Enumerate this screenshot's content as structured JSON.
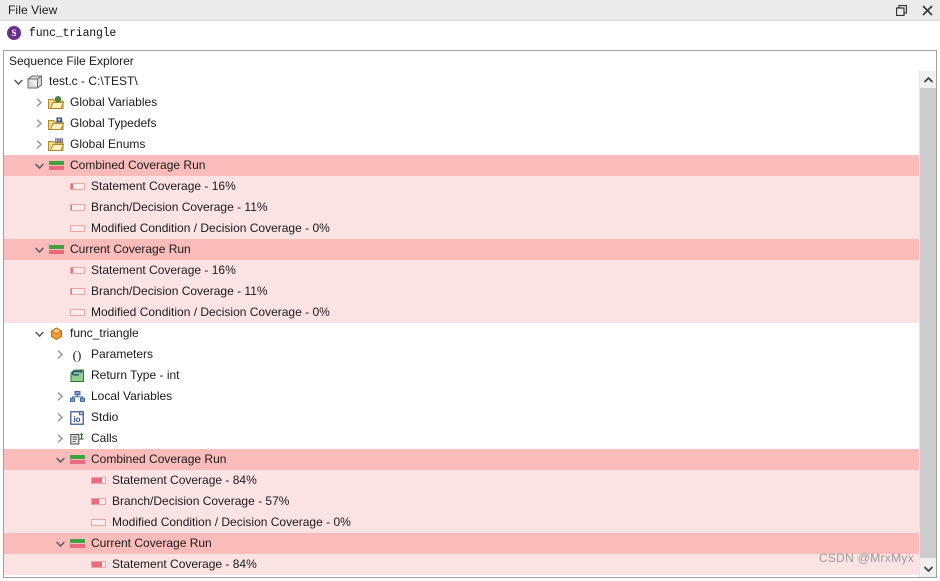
{
  "window": {
    "title": "File View",
    "controls": [
      {
        "name": "restore-window-button",
        "icon": "restore-icon"
      },
      {
        "name": "close-window-button",
        "icon": "close-icon"
      }
    ]
  },
  "tab": {
    "icon": "sequence-file-icon",
    "icon_letter": "S",
    "label": "func_triangle"
  },
  "explorer": {
    "header": "Sequence File Explorer"
  },
  "colors": {
    "highlight_dark": "#fabbbb",
    "highlight_light": "#fbe3e3",
    "coverage_fill": "#ea6b7e",
    "coverage_track": "#fdecec",
    "run_green": "#41a33f",
    "titlebar": "#ebebeb",
    "scrollbar_thumb": "#cdcdcd",
    "tab_icon": "#6b2f8e"
  },
  "scrollbar": {
    "up_arrow": "scroll-up-icon",
    "down_arrow": "scroll-down-icon",
    "thumb_name": "scrollbar-thumb"
  },
  "watermark": "CSDN @MrxMyx",
  "tree": {
    "rows": [
      {
        "id": "file-test-c",
        "label": "test.c - C:\\TEST\\",
        "indent": 0,
        "twisty": "expanded",
        "icon": "source-file-icon",
        "highlight": "none"
      },
      {
        "id": "global-variables",
        "label": "Global Variables",
        "indent": 1,
        "twisty": "collapsed",
        "icon": "folder-globe-icon",
        "highlight": "none"
      },
      {
        "id": "global-typedefs",
        "label": "Global Typedefs",
        "indent": 1,
        "twisty": "collapsed",
        "icon": "folder-typedef-icon",
        "highlight": "none"
      },
      {
        "id": "global-enums",
        "label": "Global Enums",
        "indent": 1,
        "twisty": "collapsed",
        "icon": "folder-enum-icon",
        "highlight": "none"
      },
      {
        "id": "file-combined-coverage-run",
        "label": "Combined Coverage Run",
        "indent": 1,
        "twisty": "expanded",
        "icon": "coverage-run-icon",
        "highlight": "dark"
      },
      {
        "id": "file-combined-statement-coverage",
        "label": "Statement Coverage - 16%",
        "indent": 2,
        "twisty": "none",
        "icon": "coverage-bar-icon",
        "percent": 16,
        "highlight": "light"
      },
      {
        "id": "file-combined-branch-coverage",
        "label": "Branch/Decision Coverage - 11%",
        "indent": 2,
        "twisty": "none",
        "icon": "coverage-bar-icon",
        "percent": 11,
        "highlight": "light"
      },
      {
        "id": "file-combined-mcdc-coverage",
        "label": "Modified Condition / Decision Coverage - 0%",
        "indent": 2,
        "twisty": "none",
        "icon": "coverage-bar-icon",
        "percent": 0,
        "highlight": "light"
      },
      {
        "id": "file-current-coverage-run",
        "label": "Current Coverage Run",
        "indent": 1,
        "twisty": "expanded",
        "icon": "coverage-run-icon",
        "highlight": "dark"
      },
      {
        "id": "file-current-statement-coverage",
        "label": "Statement Coverage - 16%",
        "indent": 2,
        "twisty": "none",
        "icon": "coverage-bar-icon",
        "percent": 16,
        "highlight": "light"
      },
      {
        "id": "file-current-branch-coverage",
        "label": "Branch/Decision Coverage - 11%",
        "indent": 2,
        "twisty": "none",
        "icon": "coverage-bar-icon",
        "percent": 11,
        "highlight": "light"
      },
      {
        "id": "file-current-mcdc-coverage",
        "label": "Modified Condition / Decision Coverage - 0%",
        "indent": 2,
        "twisty": "none",
        "icon": "coverage-bar-icon",
        "percent": 0,
        "highlight": "light"
      },
      {
        "id": "func-triangle",
        "label": "func_triangle",
        "indent": 1,
        "twisty": "expanded",
        "icon": "function-icon",
        "highlight": "none"
      },
      {
        "id": "parameters",
        "label": "Parameters",
        "indent": 2,
        "twisty": "collapsed",
        "icon": "parameters-icon",
        "highlight": "none"
      },
      {
        "id": "return-type",
        "label": "Return Type - int",
        "indent": 2,
        "twisty": "none",
        "icon": "return-type-icon",
        "highlight": "none"
      },
      {
        "id": "local-variables",
        "label": "Local Variables",
        "indent": 2,
        "twisty": "collapsed",
        "icon": "local-variables-icon",
        "highlight": "none"
      },
      {
        "id": "stdio",
        "label": "Stdio",
        "indent": 2,
        "twisty": "collapsed",
        "icon": "stdio-icon",
        "highlight": "none"
      },
      {
        "id": "calls",
        "label": "Calls",
        "indent": 2,
        "twisty": "collapsed",
        "icon": "calls-icon",
        "highlight": "none"
      },
      {
        "id": "func-combined-coverage-run",
        "label": "Combined Coverage Run",
        "indent": 2,
        "twisty": "expanded",
        "icon": "coverage-run-icon",
        "highlight": "dark"
      },
      {
        "id": "func-combined-statement-coverage",
        "label": "Statement Coverage - 84%",
        "indent": 3,
        "twisty": "none",
        "icon": "coverage-bar-icon",
        "percent": 84,
        "highlight": "light"
      },
      {
        "id": "func-combined-branch-coverage",
        "label": "Branch/Decision Coverage - 57%",
        "indent": 3,
        "twisty": "none",
        "icon": "coverage-bar-icon",
        "percent": 57,
        "highlight": "light"
      },
      {
        "id": "func-combined-mcdc-coverage",
        "label": "Modified Condition / Decision Coverage - 0%",
        "indent": 3,
        "twisty": "none",
        "icon": "coverage-bar-icon",
        "percent": 0,
        "highlight": "light"
      },
      {
        "id": "func-current-coverage-run",
        "label": "Current Coverage Run",
        "indent": 2,
        "twisty": "expanded",
        "icon": "coverage-run-icon",
        "highlight": "dark"
      },
      {
        "id": "func-current-statement-coverage",
        "label": "Statement Coverage - 84%",
        "indent": 3,
        "twisty": "none",
        "icon": "coverage-bar-icon",
        "percent": 84,
        "highlight": "light"
      }
    ]
  }
}
